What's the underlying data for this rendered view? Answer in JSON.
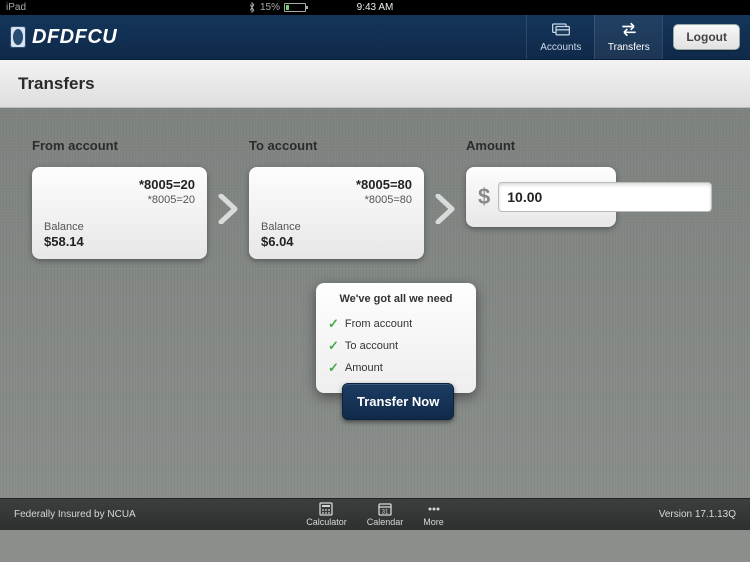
{
  "status": {
    "device": "iPad",
    "time": "9:43 AM",
    "battery_pct": "15%"
  },
  "brand": "DFDFCU",
  "nav": {
    "items": [
      {
        "label": "Accounts",
        "name": "nav-accounts",
        "active": false
      },
      {
        "label": "Transfers",
        "name": "nav-transfers",
        "active": true
      }
    ],
    "logout_label": "Logout"
  },
  "page": {
    "title": "Transfers"
  },
  "transfer": {
    "from_label": "From account",
    "to_label": "To account",
    "amount_label": "Amount",
    "from": {
      "acct_main": "*8005=20",
      "acct_sub": "*8005=20",
      "balance_label": "Balance",
      "balance_value": "$58.14"
    },
    "to": {
      "acct_main": "*8005=80",
      "acct_sub": "*8005=80",
      "balance_label": "Balance",
      "balance_value": "$6.04"
    },
    "amount": {
      "currency": "$",
      "value": "10.00"
    }
  },
  "popover": {
    "title": "We've got all we need",
    "items": [
      "From account",
      "To account",
      "Amount"
    ]
  },
  "cta": {
    "transfer_now": "Transfer Now"
  },
  "footer": {
    "insured": "Federally Insured by NCUA",
    "version": "Version 17.1.13Q",
    "items": [
      {
        "label": "Calculator",
        "name": "footer-calculator"
      },
      {
        "label": "Calendar",
        "name": "footer-calendar"
      },
      {
        "label": "More",
        "name": "footer-more"
      }
    ]
  }
}
